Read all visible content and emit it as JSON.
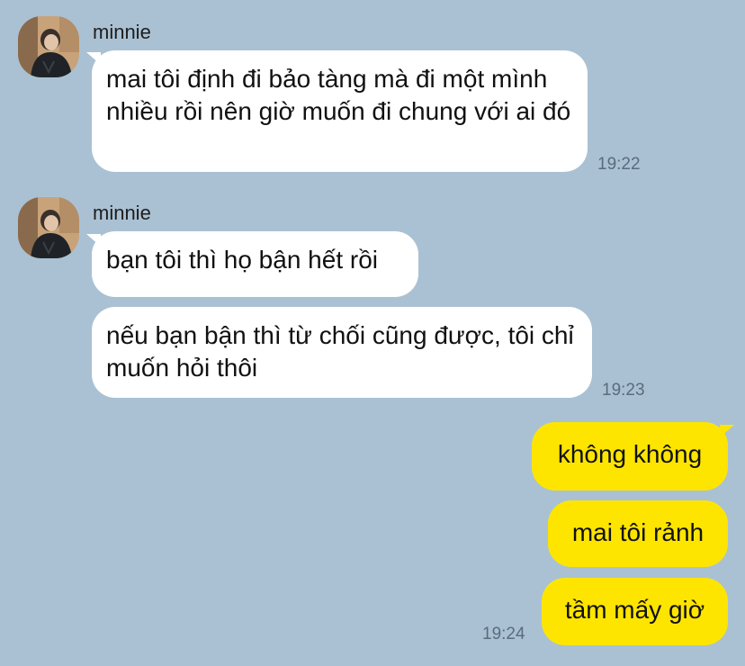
{
  "colors": {
    "background": "#aac1d3",
    "incoming_bubble": "#ffffff",
    "outgoing_bubble": "#fee500",
    "timestamp": "#5b6c7a"
  },
  "groups": [
    {
      "sender": "minnie",
      "messages": [
        {
          "text": "mai tôi định đi bảo tàng mà đi một mình nhiều rồi nên giờ muốn đi chung với ai đó"
        }
      ],
      "time": "19:22"
    },
    {
      "sender": "minnie",
      "messages": [
        {
          "text": "bạn tôi thì họ bận hết rồi"
        },
        {
          "text": "nếu bạn bận thì từ chối cũng được, tôi chỉ muốn hỏi thôi"
        }
      ],
      "time": "19:23"
    }
  ],
  "outgoing": {
    "messages": [
      {
        "text": "không không"
      },
      {
        "text": "mai tôi rảnh"
      },
      {
        "text": "tầm mấy giờ"
      }
    ],
    "time": "19:24"
  }
}
